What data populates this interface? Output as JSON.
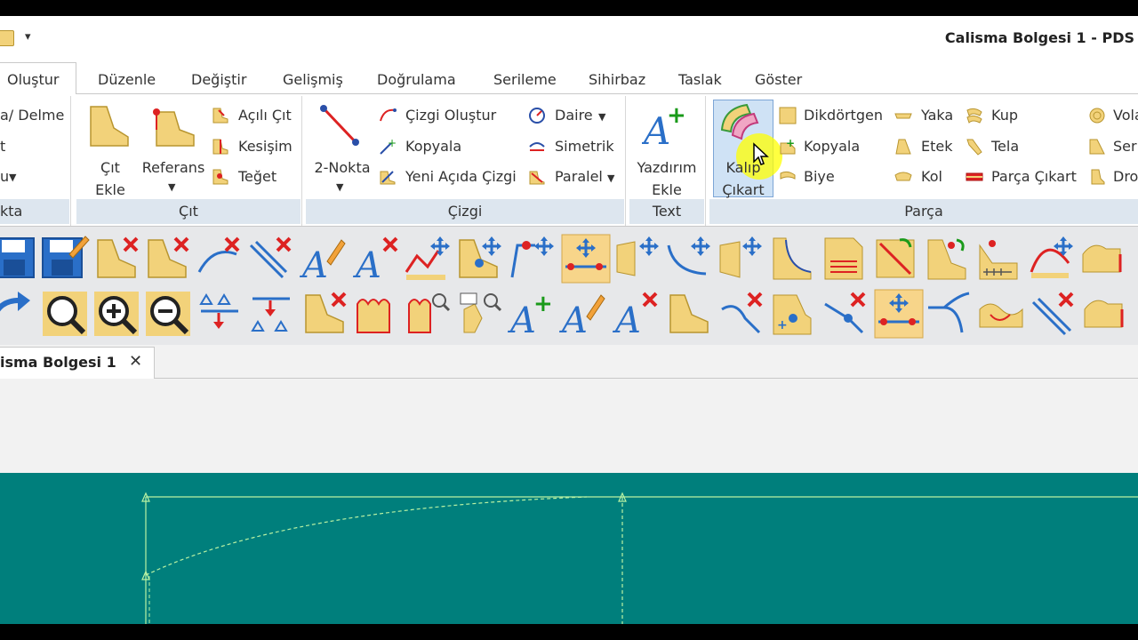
{
  "window": {
    "title": "Calisma Bolgesi 1 - PDS"
  },
  "tabs": [
    "Oluştur",
    "Düzenle",
    "Değiştir",
    "Gelişmiş",
    "Doğrulama",
    "Serileme",
    "Sihirbaz",
    "Taslak",
    "Göster"
  ],
  "ribbon": {
    "nokta": {
      "footer": "kta",
      "items": [
        "a/ Delme",
        "t",
        "u"
      ]
    },
    "cit": {
      "footer": "Çıt",
      "cit_ekle": "Çıt Ekle",
      "referans": "Referans",
      "items": [
        "Açılı Çıt",
        "Kesişim",
        "Teğet"
      ]
    },
    "cizgi": {
      "footer": "Çizgi",
      "iki_nokta": "2-Nokta",
      "col1": [
        "Çizgi Oluştur",
        "Kopyala",
        "Yeni Açıda Çizgi"
      ],
      "col2": [
        "Daire",
        "Simetrik",
        "Paralel"
      ]
    },
    "text": {
      "footer": "Text",
      "yazdirim_ekle": "Yazdırım Ekle"
    },
    "parca": {
      "footer": "Parça",
      "kalip_cikart": "Kalıp Çıkart",
      "col1": [
        "Dikdörtgen",
        "Kopyala",
        "Biye"
      ],
      "col2": [
        "Yaka",
        "Etek",
        "Kol"
      ],
      "col3": [
        "Kup",
        "Tela",
        "Parça Çıkart"
      ],
      "col4": [
        "Vola",
        "Seri",
        "Dro"
      ]
    }
  },
  "document_tab": {
    "label": "isma Bolgesi 1",
    "close": "✕"
  },
  "colors": {
    "canvas": "#007f7c",
    "pattern_line": "#b9f2a3",
    "ribbon_footer": "#dde6ef",
    "icon_yellow": "#f2d27a"
  }
}
